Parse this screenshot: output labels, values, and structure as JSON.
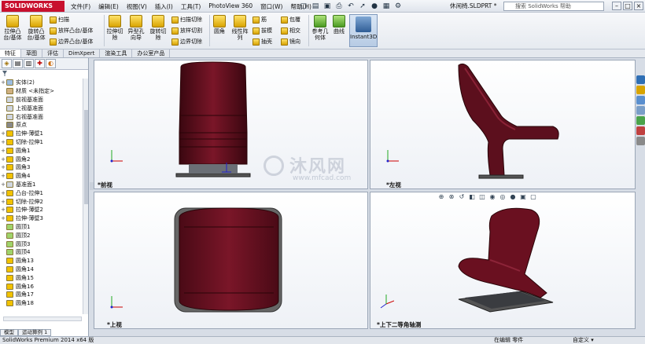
{
  "app": {
    "logo": "SOLIDWORKS",
    "document": "休闲椅.SLDPRT *"
  },
  "menu": [
    "文件(F)",
    "编辑(E)",
    "视图(V)",
    "插入(I)",
    "工具(T)",
    "PhotoView 360",
    "窗口(W)",
    "帮助(H)"
  ],
  "search": {
    "placeholder": "搜索 SolidWorks 帮助"
  },
  "ribbon": {
    "extrude_boss": "拉伸凸\n台/基体",
    "revolve_boss": "旋转凸\n台/基体",
    "sweep": "扫描",
    "loft_boss": "放样凸台/基体",
    "boundary_boss": "边界凸台/基体",
    "extrude_cut": "拉伸切\n除",
    "hole_wizard": "异型孔\n向导",
    "revolve_cut": "旋转切\n除",
    "sweep_cut": "扫描切除",
    "loft_cut": "放样切割",
    "boundary_cut": "边界切除",
    "fillet": "圆角",
    "linear_pattern": "线性阵\n列",
    "rib": "筋",
    "draft": "拔模",
    "shell": "抽壳",
    "wrap": "包覆",
    "intersect": "相交",
    "mirror": "镜向",
    "ref_geometry": "参考几\n何体",
    "curves": "曲线",
    "instant3d": "Instant3D"
  },
  "tabs": [
    "特征",
    "草图",
    "评估",
    "DimXpert",
    "渲染工具",
    "办公室产品"
  ],
  "tree": [
    "实体(2)",
    "材质 <未指定>",
    "前视基准面",
    "上视基准面",
    "右视基准面",
    "原点",
    "拉伸-薄壁1",
    "切除-拉伸1",
    "圆角1",
    "圆角2",
    "圆角3",
    "圆角4",
    "基准面1",
    "凸台-拉伸1",
    "切除-拉伸2",
    "拉伸-薄壁2",
    "拉伸-薄壁3",
    "圆顶1",
    "圆顶2",
    "圆顶3",
    "圆顶4",
    "圆角13",
    "圆角14",
    "圆角15",
    "圆角16",
    "圆角17",
    "圆角18"
  ],
  "bottom_tabs": [
    "模型",
    "运动算例 1"
  ],
  "views": {
    "front": "*前视",
    "left": "*左视",
    "top": "*上视",
    "iso": "*上下二等角轴测"
  },
  "watermark": {
    "text": "沐风网",
    "url": "www.mfcad.com"
  },
  "status": {
    "left": "SolidWorks Premium 2014 x64 版",
    "mid": "在编辑 零件",
    "right": "自定义 ▾"
  },
  "colors": {
    "chair": "#6a1020",
    "chair_dark": "#3a0710",
    "brand": "#c8102e"
  }
}
